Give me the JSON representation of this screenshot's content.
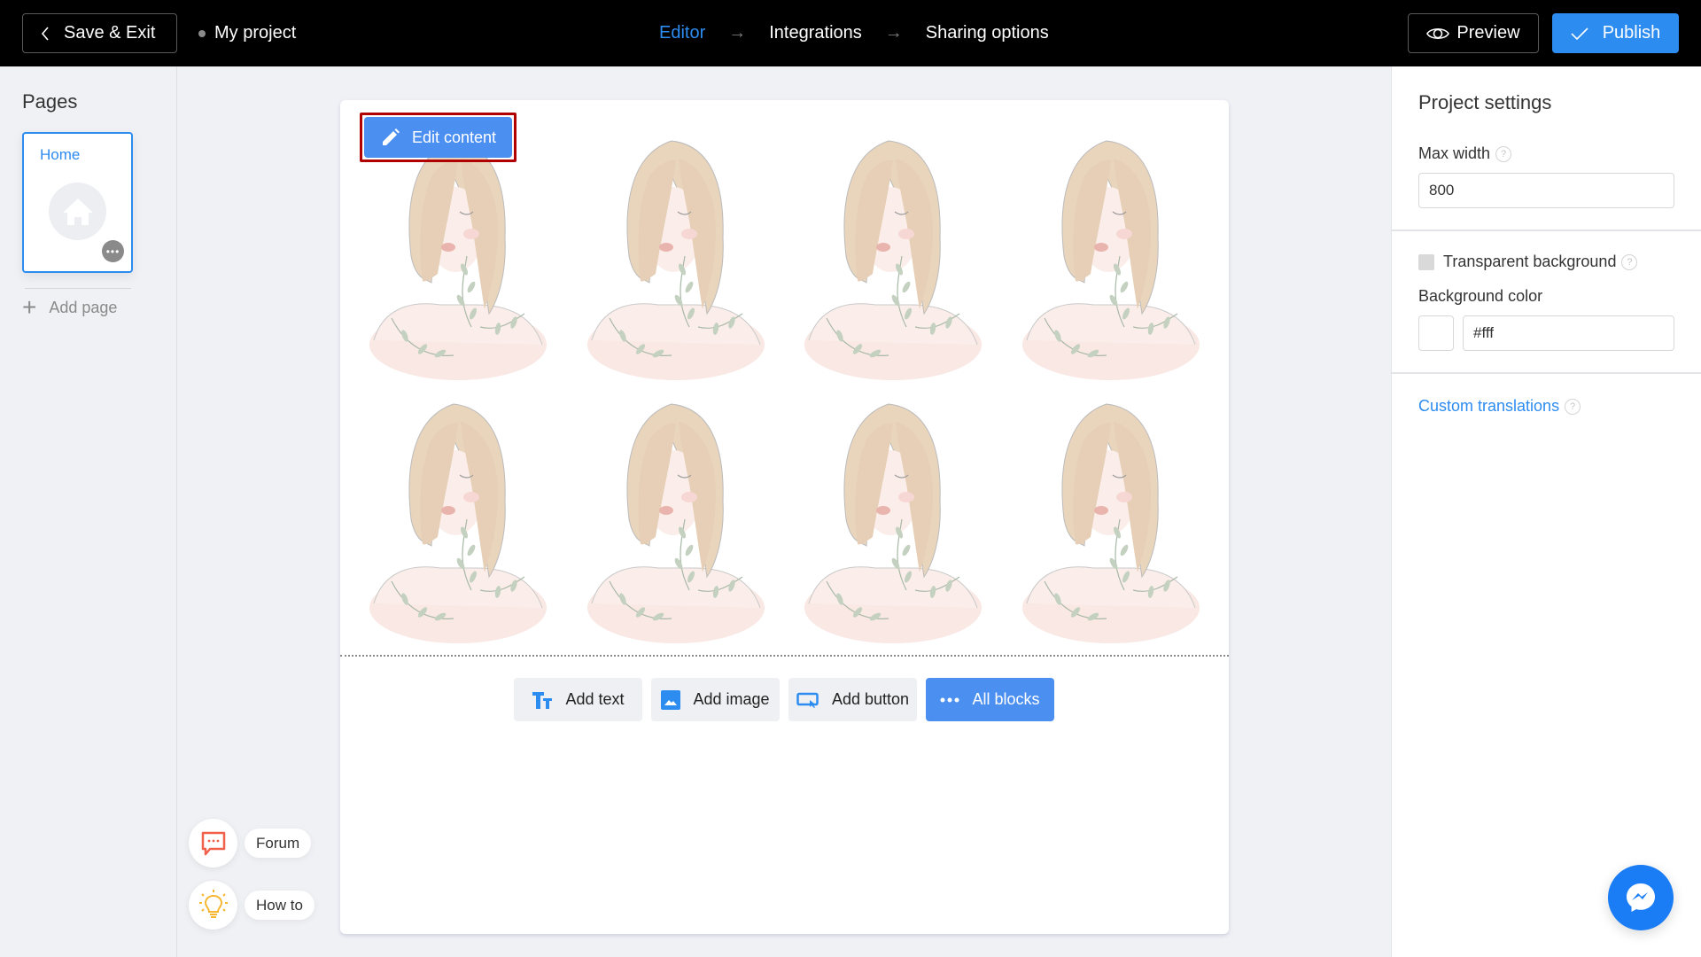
{
  "header": {
    "save_exit_label": "Save & Exit",
    "project_name": "My project",
    "steps": [
      {
        "label": "Editor",
        "active": true
      },
      {
        "label": "Integrations",
        "active": false
      },
      {
        "label": "Sharing options",
        "active": false
      }
    ],
    "preview_label": "Preview",
    "publish_label": "Publish"
  },
  "sidebar": {
    "title": "Pages",
    "pages": [
      {
        "name": "Home",
        "icon": "home-icon",
        "selected": true
      }
    ],
    "more_glyph": "•••",
    "add_page_label": "Add page"
  },
  "canvas": {
    "edit_content_label": "Edit content",
    "image_count": 8,
    "image_grid": {
      "columns": 4,
      "rows": 2
    },
    "block_buttons": [
      {
        "label": "Add text",
        "icon": "text-icon"
      },
      {
        "label": "Add image",
        "icon": "image-icon"
      },
      {
        "label": "Add button",
        "icon": "button-icon"
      },
      {
        "label": "All blocks",
        "icon": "more-dots-icon"
      }
    ]
  },
  "help": {
    "forum_label": "Forum",
    "howto_label": "How to"
  },
  "right_panel": {
    "title": "Project settings",
    "max_width_label": "Max width",
    "max_width_value": "800",
    "transparent_bg_label": "Transparent background",
    "transparent_bg_checked": false,
    "bg_color_label": "Background color",
    "bg_color_value": "#fff",
    "custom_translations_label": "Custom translations",
    "help_glyph": "?"
  },
  "colors": {
    "accent": "#2d8cf0",
    "header_bg": "#000000",
    "highlight": "#b00000",
    "messenger": "#1a7df5"
  }
}
